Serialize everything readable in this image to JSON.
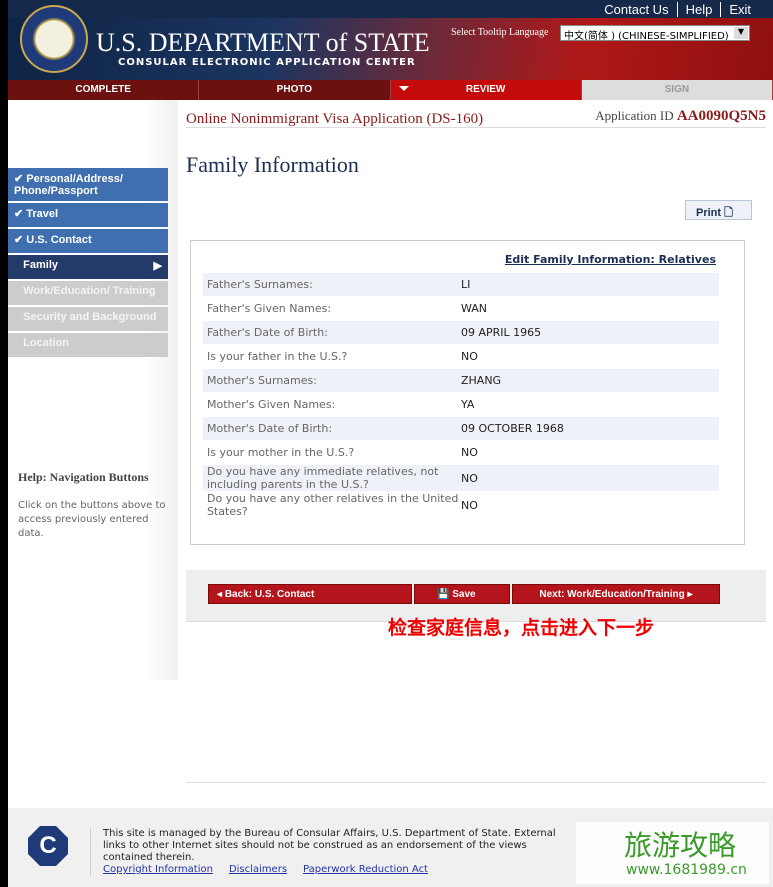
{
  "header": {
    "links": [
      "Contact Us",
      "Help",
      "Exit"
    ],
    "title": "U.S. DEPARTMENT of STATE",
    "subtitle": "CONSULAR ELECTRONIC APPLICATION CENTER",
    "lang_label": "Select Tooltip Language",
    "lang_value": "中文(简体 ) (CHINESE-SIMPLIFIED)"
  },
  "tabs": [
    "COMPLETE",
    "PHOTO",
    "REVIEW",
    "SIGN"
  ],
  "app": {
    "name": "Online Nonimmigrant Visa Application (DS-160)",
    "id_label": "Application ID",
    "id": "AA0090Q5N5"
  },
  "nav": [
    "Personal/Address/ Phone/Passport",
    "Travel",
    "U.S. Contact",
    "Family",
    "Work/Education/ Training",
    "Security and Background",
    "Location"
  ],
  "help": {
    "title": "Help:",
    "topic": "Navigation Buttons",
    "body": "Click on the buttons above to access previously entered data."
  },
  "page_title": "Family Information",
  "print": "Print",
  "edit_link": "Edit Family Information: Relatives",
  "rows": [
    [
      "Father's Surnames:",
      "LI"
    ],
    [
      "Father's Given Names:",
      "WAN"
    ],
    [
      "Father's Date of Birth:",
      "09 APRIL 1965"
    ],
    [
      "Is your father in the U.S.?",
      "NO"
    ],
    [
      "Mother's Surnames:",
      "ZHANG"
    ],
    [
      "Mother's Given Names:",
      "YA"
    ],
    [
      "Mother's Date of Birth:",
      "09 OCTOBER 1968"
    ],
    [
      "Is your mother in the U.S.?",
      "NO"
    ],
    [
      "Do you have any immediate relatives, not including parents in the U.S.?",
      "NO"
    ],
    [
      "Do you have any other relatives in the United States?",
      "NO"
    ]
  ],
  "buttons": {
    "back": "Back: U.S. Contact",
    "save": "Save",
    "next": "Next: Work/Education/Training"
  },
  "annotation": "检查家庭信息，点击进入下一步",
  "footer": {
    "text": "This site is managed by the Bureau of Consular Affairs, U.S. Department of State. External links to other Internet sites should not be construed as an endorsement of the views contained therein.",
    "links": [
      "Copyright Information",
      "Disclaimers",
      "Paperwork Reduction Act"
    ]
  },
  "watermark": {
    "text": "旅游攻略",
    "url": "www.1681989.cn"
  }
}
